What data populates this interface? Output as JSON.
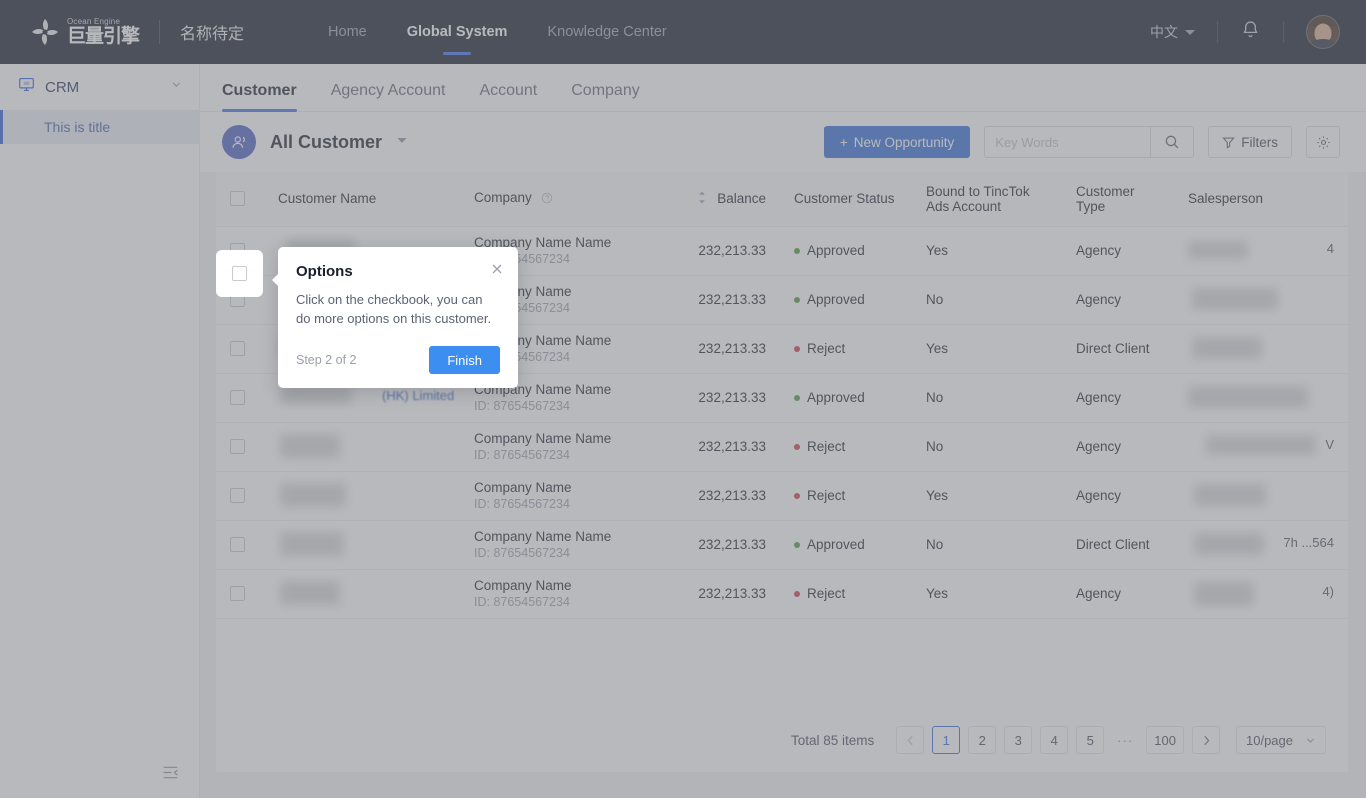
{
  "header": {
    "logo_en": "Ocean Engine",
    "logo_cn": "巨量引擎",
    "brand_sub": "名称待定",
    "nav": [
      {
        "label": "Home",
        "active": false
      },
      {
        "label": "Global System",
        "active": true
      },
      {
        "label": "Knowledge Center",
        "active": false
      }
    ],
    "language": "中文",
    "bell_icon": "bell-icon",
    "avatar_icon": "user-avatar"
  },
  "sidebar": {
    "group": {
      "label": "CRM",
      "icon": "monitor-icon",
      "chevron": "chevron-down-icon"
    },
    "items": [
      {
        "label": "This is title",
        "active": true
      }
    ],
    "collapse_icon": "collapse-sidebar-icon"
  },
  "tabs": [
    {
      "label": "Customer",
      "active": true
    },
    {
      "label": "Agency Account",
      "active": false
    },
    {
      "label": "Account",
      "active": false
    },
    {
      "label": "Company",
      "active": false
    }
  ],
  "toolbar": {
    "avatar_icon": "customers-group-icon",
    "title": "All Customer",
    "caret_icon": "chevron-down-icon",
    "new_opportunity_label": "New Opportunity",
    "new_opportunity_plus": "+",
    "search_placeholder": "Key Words",
    "search_value": "",
    "search_icon": "search-icon",
    "filters_label": "Filters",
    "filters_icon": "filter-icon",
    "settings_icon": "gear-icon"
  },
  "table": {
    "columns": [
      {
        "key": "chk",
        "label": ""
      },
      {
        "key": "name",
        "label": "Customer Name"
      },
      {
        "key": "company",
        "label": "Company",
        "help_icon": "help-circle-icon"
      },
      {
        "key": "balance",
        "label": "Balance",
        "sort_icon": "sort-updown-icon"
      },
      {
        "key": "status",
        "label": "Customer Status"
      },
      {
        "key": "bound",
        "label": "Bound to TincTok Ads Account"
      },
      {
        "key": "type",
        "label": "Customer Type"
      },
      {
        "key": "sales",
        "label": "Salesperson"
      }
    ],
    "rows": [
      {
        "name": "",
        "company": "Company Name Name",
        "company_id": "ID: 87654567234",
        "balance": "232,213.33",
        "status": "Approved",
        "status_kind": "ok",
        "bound": "Yes",
        "type": "Agency",
        "sales": "4"
      },
      {
        "name": "",
        "company": "Company Name",
        "company_id": "ID: 87654567234",
        "balance": "232,213.33",
        "status": "Approved",
        "status_kind": "ok",
        "bound": "No",
        "type": "Agency",
        "sales": ""
      },
      {
        "name": "",
        "company": "Company Name Name",
        "company_id": "ID: 87654567234",
        "balance": "232,213.33",
        "status": "Reject",
        "status_kind": "no",
        "bound": "Yes",
        "type": "Direct Client",
        "sales": ""
      },
      {
        "name": "(HK) Limited",
        "company": "Company Name Name",
        "company_id": "ID: 87654567234",
        "balance": "232,213.33",
        "status": "Approved",
        "status_kind": "ok",
        "bound": "No",
        "type": "Agency",
        "sales": ""
      },
      {
        "name": "",
        "company": "Company Name Name",
        "company_id": "ID: 87654567234",
        "balance": "232,213.33",
        "status": "Reject",
        "status_kind": "no",
        "bound": "No",
        "type": "Agency",
        "sales": "V"
      },
      {
        "name": "",
        "company": "Company Name",
        "company_id": "ID: 87654567234",
        "balance": "232,213.33",
        "status": "Reject",
        "status_kind": "no",
        "bound": "Yes",
        "type": "Agency",
        "sales": ""
      },
      {
        "name": "",
        "company": "Company Name Name",
        "company_id": "ID: 87654567234",
        "balance": "232,213.33",
        "status": "Approved",
        "status_kind": "ok",
        "bound": "No",
        "type": "Direct Client",
        "sales": "7h                     ...564"
      },
      {
        "name": "",
        "company": "Company Name",
        "company_id": "ID: 87654567234",
        "balance": "232,213.33",
        "status": "Reject",
        "status_kind": "no",
        "bound": "Yes",
        "type": "Agency",
        "sales": "4)"
      }
    ]
  },
  "pagination": {
    "total_label": "Total 85 items",
    "prev_icon": "chevron-left-icon",
    "next_icon": "chevron-right-icon",
    "pages": [
      "1",
      "2",
      "3",
      "4",
      "5"
    ],
    "ellipsis": "···",
    "last_page": "100",
    "current": "1",
    "page_size": "10/page",
    "page_size_caret": "chevron-down-icon"
  },
  "popover": {
    "title": "Options",
    "close_icon": "close-icon",
    "body": "Click on the checkbook, you can do more options on this customer.",
    "step": "Step 2 of 2",
    "finish_label": "Finish"
  },
  "colors": {
    "header_bg": "#131a2c",
    "accent_blue": "#2f6ad9",
    "tab_underline": "#3c6df0",
    "status_ok": "#4e9a3e",
    "status_reject": "#cf3b4b",
    "finish_btn": "#3c8ef0",
    "sidebar_active_bg": "#e9edf5"
  }
}
